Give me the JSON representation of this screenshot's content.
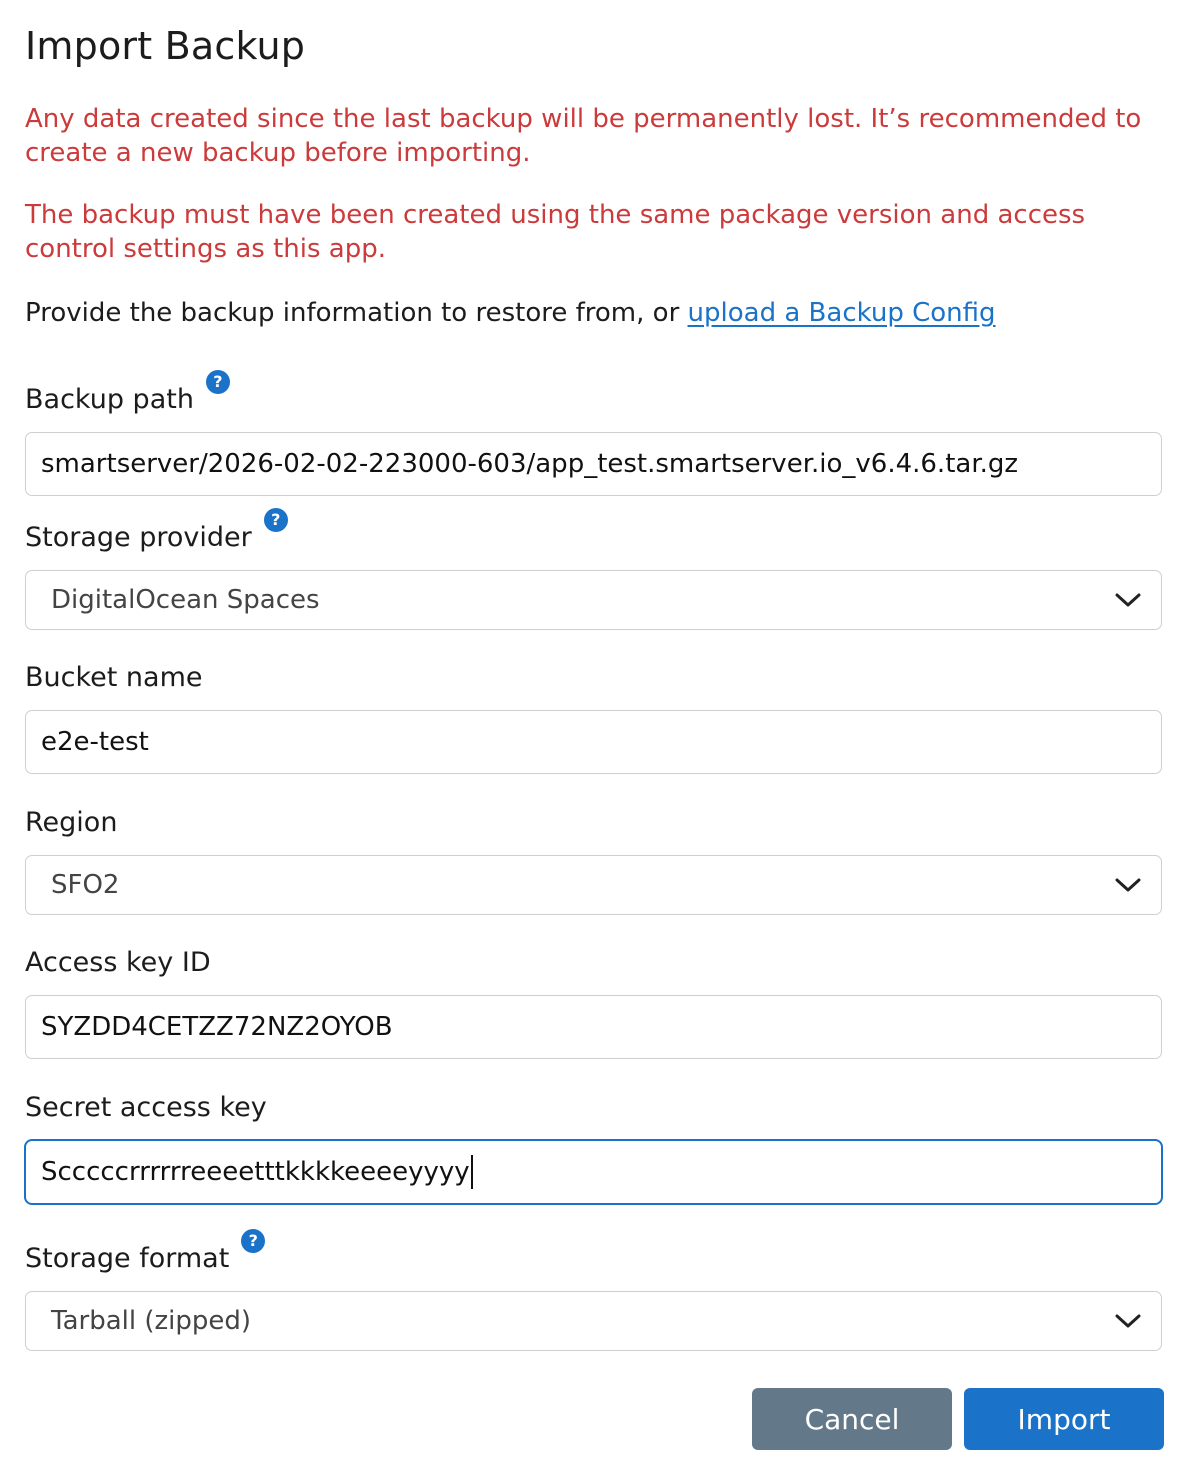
{
  "dialog": {
    "title": "Import Backup",
    "warning_1": "Any data created since the last backup will be permanently lost. It’s recommended to create a new backup before importing.",
    "warning_2": "The backup must have been created using the same package version and access control settings as this app.",
    "intro_text": "Provide the backup information to restore from, or ",
    "intro_link": "upload a Backup Config"
  },
  "fields": {
    "backup_path": {
      "label": "Backup path",
      "value": "smartserver/2026-02-02-223000-603/app_test.smartserver.io_v6.4.6.tar.gz"
    },
    "storage_provider": {
      "label": "Storage provider",
      "value": "DigitalOcean Spaces"
    },
    "bucket_name": {
      "label": "Bucket name",
      "value": "e2e-test"
    },
    "region": {
      "label": "Region",
      "value": "SFO2"
    },
    "access_key_id": {
      "label": "Access key ID",
      "value": "SYZDD4CETZZ72NZ2OYOB"
    },
    "secret_access_key": {
      "label": "Secret access key",
      "value": "Scccccrrrrrreeeetttkkkkeeeeyyyy"
    },
    "storage_format": {
      "label": "Storage format",
      "value": "Tarball (zipped)"
    }
  },
  "help_icon_glyph": "?",
  "buttons": {
    "cancel": "Cancel",
    "import": "Import"
  },
  "colors": {
    "warning": "#cc3b3b",
    "link": "#1a73c9",
    "primary": "#1a73c9",
    "secondary": "#63798a"
  }
}
